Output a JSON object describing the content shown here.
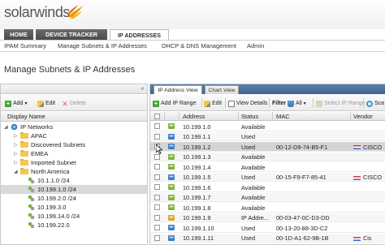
{
  "brand": {
    "name": "solarwinds"
  },
  "top_tabs": [
    {
      "label": "HOME"
    },
    {
      "label": "DEVICE TRACKER"
    },
    {
      "label": "IP ADDRESSES"
    }
  ],
  "sub_nav": [
    {
      "label": "IPAM Summary"
    },
    {
      "label": "Manage Subnets & IP Addresses"
    },
    {
      "label": "DHCP & DNS Management"
    },
    {
      "label": "Admin"
    }
  ],
  "page_title": "Manage Subnets & IP Addresses",
  "left_panel": {
    "collapse_glyph": "«",
    "toolbar": {
      "add": "Add",
      "add_caret": "▾",
      "edit": "Edit",
      "delete": "Delete"
    },
    "column_header": "Display Name",
    "tree": [
      {
        "label": "IP Networks"
      },
      {
        "label": "APAC"
      },
      {
        "label": "Discovered Subnets"
      },
      {
        "label": "EMEA"
      },
      {
        "label": "Imported Subnet"
      },
      {
        "label": "North America"
      },
      {
        "label": "10.1.1.0 /24"
      },
      {
        "label": "10.199.1.0 /24"
      },
      {
        "label": "10.199.2.0 /24"
      },
      {
        "label": "10.199.3.0"
      },
      {
        "label": "10.199.14.0 /24"
      },
      {
        "label": "10.199.22.0"
      }
    ]
  },
  "right_panel": {
    "tabs": [
      {
        "label": "IP Address View"
      },
      {
        "label": "Chart View"
      }
    ],
    "toolbar": {
      "add_ip_range": "Add IP Range",
      "edit": "Edit",
      "view_details": "View Details",
      "filter": "Filter",
      "filter_all": "All",
      "select_ip_range": "Select IP Range",
      "scan": "Sca"
    },
    "columns": {
      "address": "Address",
      "status": "Status",
      "mac": "MAC",
      "vendor": "Vendor"
    },
    "rows": [
      {
        "address": "10.199.1.0",
        "status": "Available",
        "mac": "",
        "vendor": ""
      },
      {
        "address": "10.199.1.1",
        "status": "Used",
        "mac": "",
        "vendor": ""
      },
      {
        "address": "10.199.1.2",
        "status": "Used",
        "mac": "00-12-D9-74-B5-F1",
        "vendor": "CISCO"
      },
      {
        "address": "10.199.1.3",
        "status": "Available",
        "mac": "",
        "vendor": ""
      },
      {
        "address": "10.199.1.4",
        "status": "Available",
        "mac": "",
        "vendor": ""
      },
      {
        "address": "10.199.1.5",
        "status": "Used",
        "mac": "00-15-F9-F7-85-41",
        "vendor": "CISCO"
      },
      {
        "address": "10.199.1.6",
        "status": "Available",
        "mac": "",
        "vendor": ""
      },
      {
        "address": "10.199.1.7",
        "status": "Available",
        "mac": "",
        "vendor": ""
      },
      {
        "address": "10.199.1.8",
        "status": "Available",
        "mac": "",
        "vendor": ""
      },
      {
        "address": "10.199.1.9",
        "status": "IP Addre...",
        "mac": "00-03-47-0C-D3-DD",
        "vendor": ""
      },
      {
        "address": "10.199.1.10",
        "status": "Used",
        "mac": "00-13-20-88-3D-C2",
        "vendor": ""
      },
      {
        "address": "10.199.1.11",
        "status": "Used",
        "mac": "00-1D-A1-62-9B-1B",
        "vendor": "Cis"
      }
    ]
  },
  "colors": {
    "brand_orange": "#f29400",
    "tab_dark": "#4a4a4a",
    "panel_tab_blue": "#3e6491",
    "selection": "#d5d5d5"
  }
}
